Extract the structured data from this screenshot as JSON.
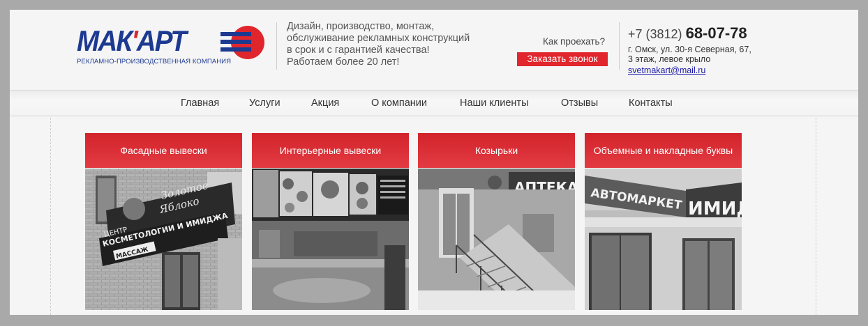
{
  "logo": {
    "name_main": "МАК",
    "name_apostrophe": "'",
    "name_rest": "АРТ",
    "subtitle": "РЕКЛАМНО-ПРОИЗВОДСТВЕННАЯ КОМПАНИЯ",
    "colors": {
      "blue": "#1d3a91",
      "red": "#d9262c"
    }
  },
  "slogan": {
    "lines": [
      "Дизайн, производство, монтаж,",
      "обслуживание рекламных конструкций",
      "в срок и с гарантией качества!",
      "Работаем более 20 лет!"
    ]
  },
  "actions": {
    "how_to_get": "Как проехать?",
    "call_button": "Заказать звонок",
    "accent": "#e1262d"
  },
  "contacts": {
    "phone_prefix": "+7 (3812)",
    "phone_number": "68-07-78",
    "address_lines": [
      "г. Омск, ул. 30-я Северная, 67,",
      "3 этаж, левое крыло"
    ],
    "email": "svetmakart@mail.ru"
  },
  "nav": {
    "items": [
      "Главная",
      "Услуги",
      "Акция",
      "О компании",
      "Наши клиенты",
      "Отзывы",
      "Контакты"
    ]
  },
  "services": [
    {
      "title": "Фасадные вывески",
      "sign_line1": "Золотое",
      "sign_line2": "Яблоко",
      "sign_line3": "ЦЕНТР",
      "sign_line4": "КОСМЕТОЛОГИИ И ИМИДЖА",
      "sign_line5": "МАССАЖ"
    },
    {
      "title": "Интерьерные вывески"
    },
    {
      "title": "Козырьки",
      "sign": "АПТЕКА"
    },
    {
      "title": "Объемные и накладные буквы",
      "sign": "АВТОМАРКЕТ",
      "sign2": "ИМИД"
    }
  ]
}
